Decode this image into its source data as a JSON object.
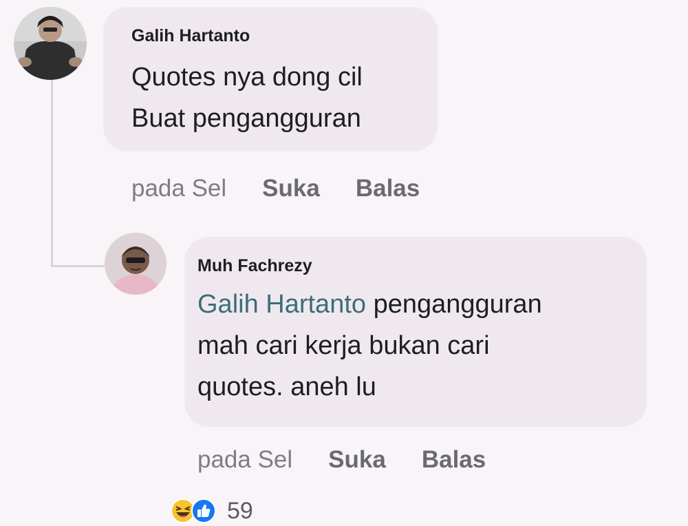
{
  "comments": [
    {
      "author": "Galih Hartanto",
      "text_lines": [
        "Quotes nya dong cil",
        "Buat pengangguran"
      ],
      "timestamp": "pada Sel",
      "like_label": "Suka",
      "reply_label": "Balas"
    },
    {
      "author": "Muh Fachrezy",
      "mention": "Galih Hartanto",
      "text_after_mention": " pengangguran",
      "text_lines": [
        "mah cari kerja bukan cari",
        "quotes. aneh lu"
      ],
      "timestamp": "pada Sel",
      "like_label": "Suka",
      "reply_label": "Balas"
    }
  ],
  "reactions": {
    "icons": [
      "haha-icon",
      "like-icon"
    ],
    "count": "59"
  },
  "colors": {
    "background": "#f8f4f8",
    "bubble": "#efe9ef",
    "mention": "#3d6d7a",
    "like_blue": "#1877f2",
    "haha_yellow": "#f7c431"
  }
}
